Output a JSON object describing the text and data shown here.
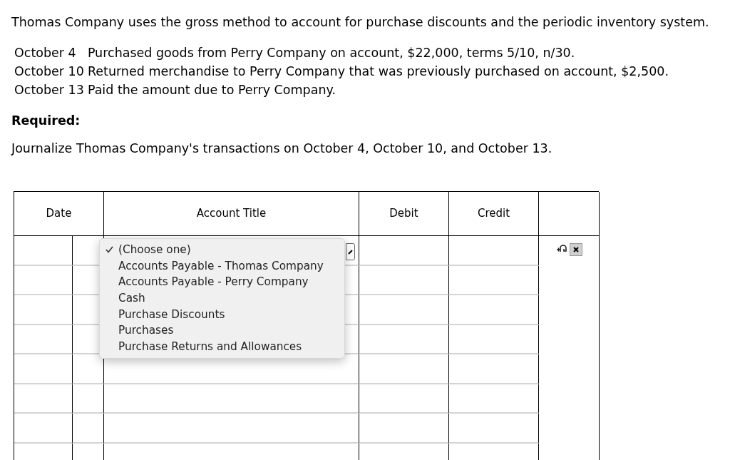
{
  "intro": "Thomas Company uses the gross method to account for purchase discounts and the periodic inventory system.",
  "transactions": [
    {
      "date": "October 4",
      "text": "Purchased goods from Perry Company on account, $22,000, terms 5/10, n/30."
    },
    {
      "date": "October 10",
      "text": "Returned merchandise to Perry Company that was previously purchased on account, $2,500."
    },
    {
      "date": "October 13",
      "text": "Paid the amount due to Perry Company."
    }
  ],
  "required_label": "Required:",
  "instruction": "Journalize Thomas Company's transactions on October 4, October 10, and October 13.",
  "journal": {
    "columns": [
      "Date",
      "Account Title",
      "Debit",
      "Credit"
    ],
    "dropdown": {
      "options": [
        {
          "label": "(Choose one)",
          "selected": true
        },
        {
          "label": "Accounts Payable - Thomas Company",
          "selected": false
        },
        {
          "label": "Accounts Payable - Perry Company",
          "selected": false
        },
        {
          "label": "Cash",
          "selected": false
        },
        {
          "label": "Purchase Discounts",
          "selected": false
        },
        {
          "label": "Purchases",
          "selected": false
        },
        {
          "label": "Purchase Returns and Allowances",
          "selected": false
        }
      ]
    }
  }
}
